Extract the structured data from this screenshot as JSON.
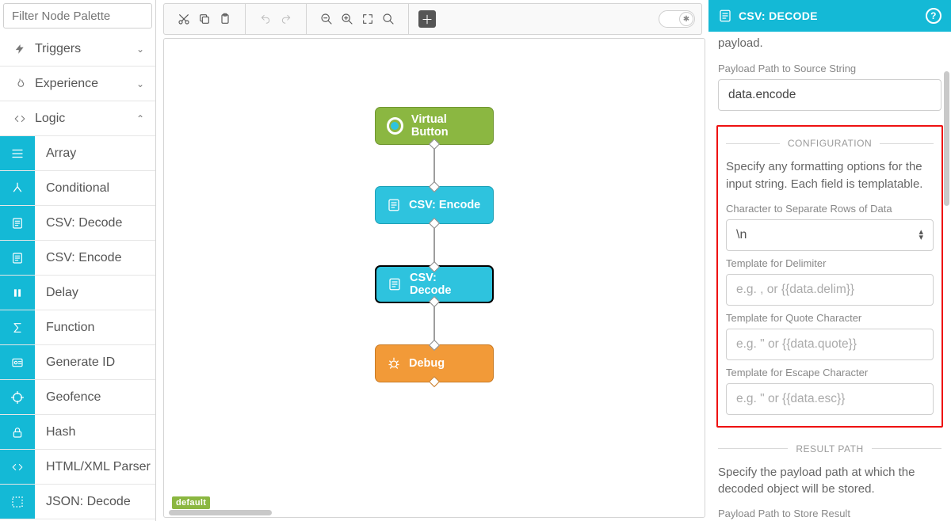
{
  "palette": {
    "filter_placeholder": "Filter Node Palette",
    "categories": [
      {
        "label": "Triggers",
        "icon": "bolt",
        "expanded": false
      },
      {
        "label": "Experience",
        "icon": "flame",
        "expanded": false
      },
      {
        "label": "Logic",
        "icon": "code",
        "expanded": true
      }
    ],
    "logic_nodes": [
      {
        "label": "Array",
        "icon": "list"
      },
      {
        "label": "Conditional",
        "icon": "branch"
      },
      {
        "label": "CSV: Decode",
        "icon": "sheet"
      },
      {
        "label": "CSV: Encode",
        "icon": "sheet"
      },
      {
        "label": "Delay",
        "icon": "pause"
      },
      {
        "label": "Function",
        "icon": "sigma"
      },
      {
        "label": "Generate ID",
        "icon": "id"
      },
      {
        "label": "Geofence",
        "icon": "target"
      },
      {
        "label": "Hash",
        "icon": "lock"
      },
      {
        "label": "HTML/XML Parser",
        "icon": "code"
      },
      {
        "label": "JSON: Decode",
        "icon": "dots"
      }
    ]
  },
  "toolbar": {
    "groups": [
      "cut",
      "copy",
      "paste",
      "undo",
      "redo",
      "zoom-out",
      "zoom-in",
      "fit",
      "zoom-reset",
      "add"
    ]
  },
  "flow_nodes": {
    "n1": "Virtual Button",
    "n2": "CSV: Encode",
    "n3": "CSV: Decode",
    "n4": "Debug"
  },
  "canvas_tag": "default",
  "panel": {
    "title": "CSV: DECODE",
    "cutoff_text": "payload.",
    "src_label": "Payload Path to Source String",
    "src_value": "data.encode",
    "config_heading": "CONFIGURATION",
    "config_helper": "Specify any formatting options for the input string. Each field is templatable.",
    "row_sep_label": "Character to Separate Rows of Data",
    "row_sep_value": "\\n",
    "delim_label": "Template for Delimiter",
    "delim_placeholder": "e.g. , or {{data.delim}}",
    "quote_label": "Template for Quote Character",
    "quote_placeholder": "e.g. \" or {{data.quote}}",
    "escape_label": "Template for Escape Character",
    "escape_placeholder": "e.g. \" or {{data.esc}}",
    "result_heading": "RESULT PATH",
    "result_helper": "Specify the payload path at which the decoded object will be stored.",
    "result_label": "Payload Path to Store Result"
  }
}
